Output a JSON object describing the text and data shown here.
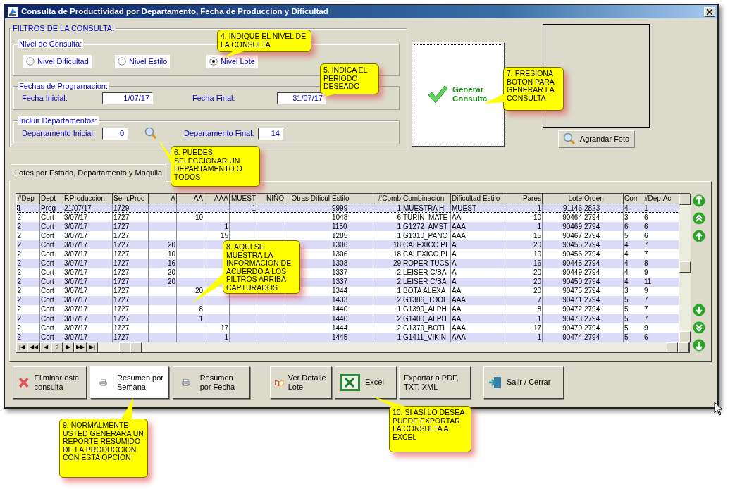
{
  "window": {
    "title": "Consulta de Productividad por Departamento, Fecha de Produccion y Dificultad"
  },
  "filters": {
    "title": "FILTROS DE LA CONSULTA:",
    "nivel": {
      "title": "Nivel de Consulta:",
      "options": [
        {
          "label": "Nivel Dificultad",
          "selected": false
        },
        {
          "label": "Nivel Estilo",
          "selected": false
        },
        {
          "label": "Nivel Lote",
          "selected": true
        }
      ]
    },
    "fechas": {
      "title": "Fechas de Programacion:",
      "fields": [
        {
          "label": "Fecha Inicial:",
          "value": "1/07/17"
        },
        {
          "label": "Fecha Final:",
          "value": "31/07/17"
        }
      ]
    },
    "departamentos": {
      "title": "Incluir Departamentos:",
      "fields": [
        {
          "label": "Departamento Inicial:",
          "value": "0"
        },
        {
          "label": "Departamento Final:",
          "value": "14"
        }
      ]
    }
  },
  "generate_button": {
    "label": "Generar Consulta"
  },
  "photo": {
    "button": "Agrandar Foto"
  },
  "tabs": [
    {
      "label": "Lotes por Estado, Departamento y Maquila",
      "selected": true
    }
  ],
  "table": {
    "columns": [
      {
        "label": "#Dep"
      },
      {
        "label": "Dept"
      },
      {
        "label": "F.Produccion"
      },
      {
        "label": "Sem.Prod"
      },
      {
        "label": "A"
      },
      {
        "label": "AA"
      },
      {
        "label": "AAA"
      },
      {
        "label": "MUEST"
      },
      {
        "label": "NIÑO"
      },
      {
        "label": "Otras Dificul"
      },
      {
        "label": "Estilo"
      },
      {
        "label": "#Comb"
      },
      {
        "label": "Combinacion"
      },
      {
        "label": "Dificultad Estilo"
      },
      {
        "label": "Pares"
      },
      {
        "label": "Lote"
      },
      {
        "label": "Orden"
      },
      {
        "label": "Corr"
      },
      {
        "label": "#Dep.Ac"
      }
    ],
    "rows": [
      {
        "selected": true,
        "cells": [
          "1",
          "Prog",
          "21/07/17",
          "1729",
          null,
          null,
          null,
          "1",
          null,
          null,
          "9999",
          "1",
          "MUESTRA H",
          "MUEST",
          "1",
          "91146",
          "2823",
          "4",
          "1"
        ]
      },
      {
        "selected": false,
        "cells": [
          "2",
          "Cort",
          "3/07/17",
          "1727",
          null,
          "10",
          null,
          null,
          null,
          null,
          "1048",
          "6",
          "TURIN_MATE",
          "AA",
          "10",
          "90464",
          "2794",
          "3",
          "6"
        ]
      },
      {
        "selected": false,
        "cells": [
          "2",
          "Cort",
          "3/07/17",
          "1727",
          null,
          null,
          "1",
          null,
          null,
          null,
          "1150",
          "1",
          "G1272_AMST",
          "AAA",
          "1",
          "90469",
          "2794",
          "6",
          "6"
        ]
      },
      {
        "selected": false,
        "cells": [
          "2",
          "Cort",
          "3/07/17",
          "1727",
          null,
          null,
          "15",
          null,
          null,
          null,
          "1285",
          "1",
          "G1310_PANC",
          "AAA",
          "15",
          "90467",
          "2794",
          "5",
          "6"
        ]
      },
      {
        "selected": false,
        "cells": [
          "2",
          "Cort",
          "3/07/17",
          "1727",
          "20",
          null,
          null,
          null,
          null,
          null,
          "1306",
          "18",
          "CALEXICO PI",
          "A",
          "20",
          "90455",
          "2794",
          "4",
          "7"
        ]
      },
      {
        "selected": false,
        "cells": [
          "2",
          "Cort",
          "3/07/17",
          "1727",
          "10",
          null,
          null,
          null,
          null,
          null,
          "1306",
          "18",
          "CALEXICO PI",
          "A",
          "10",
          "90456",
          "2794",
          "4",
          "7"
        ]
      },
      {
        "selected": false,
        "cells": [
          "2",
          "Cort",
          "3/07/17",
          "1727",
          "16",
          null,
          null,
          null,
          null,
          null,
          "1308",
          "29",
          "ROPER TUCS",
          "A",
          "16",
          "90445",
          "2794",
          "4",
          "8"
        ]
      },
      {
        "selected": false,
        "cells": [
          "2",
          "Cort",
          "3/07/17",
          "1727",
          "20",
          null,
          null,
          null,
          null,
          null,
          "1337",
          "2",
          "LEISER C/BA",
          "A",
          "20",
          "90449",
          "2794",
          "4",
          "9"
        ]
      },
      {
        "selected": false,
        "cells": [
          "2",
          "Cort",
          "3/07/17",
          "1727",
          "20",
          null,
          null,
          null,
          null,
          null,
          "1337",
          "2",
          "LEISER C/BA",
          "A",
          "20",
          "90450",
          "2794",
          "4",
          "11"
        ]
      },
      {
        "selected": false,
        "cells": [
          "2",
          "Cort",
          "3/07/17",
          "1727",
          null,
          "20",
          null,
          null,
          null,
          null,
          "1344",
          "1",
          "BOTA ALEXA",
          "AA",
          "20",
          "90475",
          "2794",
          "3",
          "9"
        ]
      },
      {
        "selected": false,
        "cells": [
          "2",
          "Cort",
          "3/07/17",
          "1727",
          null,
          null,
          null,
          null,
          null,
          null,
          "1433",
          "2",
          "G1386_TOOL",
          "AAA",
          "7",
          "90471",
          "2794",
          "5",
          "7"
        ]
      },
      {
        "selected": false,
        "cells": [
          "2",
          "Cort",
          "3/07/17",
          "1727",
          null,
          "8",
          null,
          null,
          null,
          null,
          "1440",
          "1",
          "G1399_ALPH",
          "AA",
          "8",
          "90472",
          "2794",
          "5",
          "7"
        ]
      },
      {
        "selected": false,
        "cells": [
          "2",
          "Cort",
          "3/07/17",
          "1727",
          null,
          "1",
          null,
          null,
          null,
          null,
          "1440",
          "2",
          "G1400_ALPH",
          "AA",
          "1",
          "90473",
          "2794",
          "5",
          "7"
        ]
      },
      {
        "selected": false,
        "cells": [
          "2",
          "Cort",
          "3/07/17",
          "1727",
          null,
          null,
          "17",
          null,
          null,
          null,
          "1444",
          "2",
          "G1379_BOTI",
          "AAA",
          "17",
          "90470",
          "2794",
          "5",
          "9"
        ]
      },
      {
        "selected": false,
        "cells": [
          "2",
          "Cort",
          "3/07/17",
          "1727",
          null,
          null,
          "1",
          null,
          null,
          null,
          "1445",
          "1",
          "G1411_VIKIN",
          "AAA",
          "1",
          "90474",
          "2794",
          "5",
          "6"
        ]
      }
    ]
  },
  "nav_buttons": [
    "|◀",
    "◀◀",
    "◀",
    "?",
    "▶",
    "▶▶",
    "▶|"
  ],
  "buttons": [
    {
      "label": "Eliminar esta consulta",
      "focused": false
    },
    {
      "label": "Resumen por Semana",
      "focused": true
    },
    {
      "label": "Resumen por Fecha",
      "focused": false
    },
    {
      "label": "Ver Detalle Lote",
      "focused": false
    },
    {
      "label": "Excel",
      "focused": false
    },
    {
      "label": "Exportar a PDF, TXT, XML",
      "focused": false
    },
    {
      "label": "Salir / Cerrar",
      "focused": false
    }
  ],
  "callouts": [
    {
      "text": "4. INDIQUE EL NIVEL DE LA CONSULTA"
    },
    {
      "text": "5. INDICA EL PERIODO DESEADO"
    },
    {
      "text": "6. PUEDES SELECCIONAR UN DEPARTAMENTO O TODOS"
    },
    {
      "text": "7. PRESIONA BOTON PARA GENERAR LA CONSULTA"
    },
    {
      "text": "8. AQUI SE MUESTRA LA INFORMACION DE ACUERDO A LOS FILTROS ARRIBA CAPTURADOS"
    },
    {
      "text": "9. NORMALMENTE USTED GENERARA UN REPORTE RESUMIDO DE LA PRODUCCION CON ESTA OPCION"
    },
    {
      "text": "10. SI ASÍ LO DESEA PUEDE EXPORTAR LA CONSULTA  A EXCEL"
    }
  ]
}
